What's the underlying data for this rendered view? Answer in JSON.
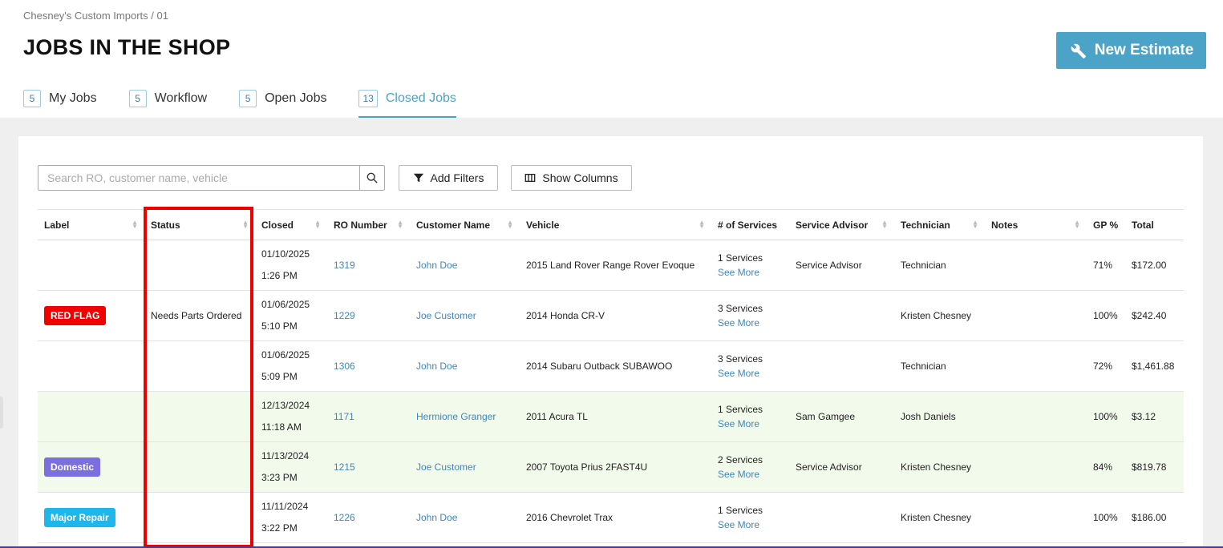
{
  "breadcrumb": "Chesney's Custom Imports / 01",
  "page_title": "JOBS IN THE SHOP",
  "new_estimate_label": "New Estimate",
  "tabs": [
    {
      "count": "5",
      "label": "My Jobs"
    },
    {
      "count": "5",
      "label": "Workflow"
    },
    {
      "count": "5",
      "label": "Open Jobs"
    },
    {
      "count": "13",
      "label": "Closed Jobs"
    }
  ],
  "search": {
    "placeholder": "Search RO, customer name, vehicle"
  },
  "toolbar": {
    "add_filters": "Add Filters",
    "show_columns": "Show Columns"
  },
  "columns": [
    "Label",
    "Status",
    "Closed",
    "RO Number",
    "Customer Name",
    "Vehicle",
    "# of Services",
    "Service Advisor",
    "Technician",
    "Notes",
    "GP %",
    "Total"
  ],
  "see_more_label": "See More",
  "rows": [
    {
      "label": "",
      "label_color": "",
      "status": "",
      "closed_date": "01/10/2025",
      "closed_time": "1:26 PM",
      "ro": "1319",
      "customer": "John Doe",
      "vehicle": "2015 Land Rover Range Rover Evoque",
      "services": "1 Services",
      "advisor": "Service Advisor",
      "technician": "Technician",
      "notes": "",
      "gp": "71%",
      "total": "$172.00",
      "green": false
    },
    {
      "label": "RED FLAG",
      "label_color": "#f20000",
      "status": "Needs Parts Ordered",
      "closed_date": "01/06/2025",
      "closed_time": "5:10 PM",
      "ro": "1229",
      "customer": "Joe Customer",
      "vehicle": "2014 Honda CR-V",
      "services": "3 Services",
      "advisor": "",
      "technician": "Kristen Chesney",
      "notes": "",
      "gp": "100%",
      "total": "$242.40",
      "green": false
    },
    {
      "label": "",
      "label_color": "",
      "status": "",
      "closed_date": "01/06/2025",
      "closed_time": "5:09 PM",
      "ro": "1306",
      "customer": "John Doe",
      "vehicle": "2014 Subaru Outback SUBAWOO",
      "services": "3 Services",
      "advisor": "",
      "technician": "Technician",
      "notes": "",
      "gp": "72%",
      "total": "$1,461.88",
      "green": false
    },
    {
      "label": "",
      "label_color": "",
      "status": "",
      "closed_date": "12/13/2024",
      "closed_time": "11:18 AM",
      "ro": "1171",
      "customer": "Hermione Granger",
      "vehicle": "2011 Acura TL",
      "services": "1 Services",
      "advisor": "Sam Gamgee",
      "technician": "Josh Daniels",
      "notes": "",
      "gp": "100%",
      "total": "$3.12",
      "green": true
    },
    {
      "label": "Domestic",
      "label_color": "#7b6fe0",
      "status": "",
      "closed_date": "11/13/2024",
      "closed_time": "3:23 PM",
      "ro": "1215",
      "customer": "Joe Customer",
      "vehicle": "2007 Toyota Prius 2FAST4U",
      "services": "2 Services",
      "advisor": "Service Advisor",
      "technician": "Kristen Chesney",
      "notes": "",
      "gp": "84%",
      "total": "$819.78",
      "green": true
    },
    {
      "label": "Major Repair",
      "label_color": "#1fb6ea",
      "status": "",
      "closed_date": "11/11/2024",
      "closed_time": "3:22 PM",
      "ro": "1226",
      "customer": "John Doe",
      "vehicle": "2016 Chevrolet Trax",
      "services": "1 Services",
      "advisor": "",
      "technician": "Kristen Chesney",
      "notes": "",
      "gp": "100%",
      "total": "$186.00",
      "green": false
    }
  ],
  "colors": {
    "accent": "#4ba3c7",
    "link": "#3f86bd",
    "highlight": "#ee0000",
    "row_green": "#f2fbeb"
  }
}
